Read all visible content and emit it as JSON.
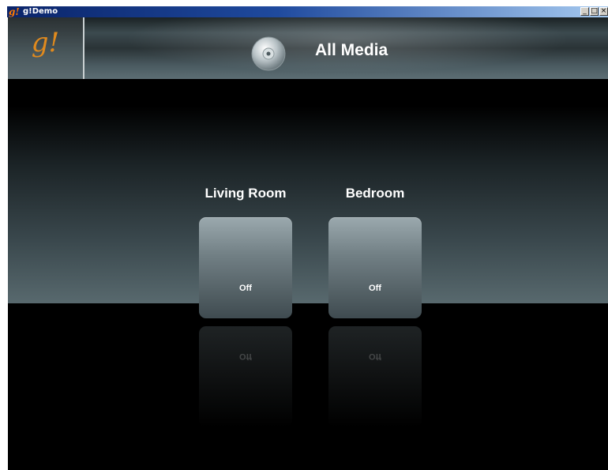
{
  "window": {
    "title": "g!Demo",
    "icon": "g-logo-icon",
    "controls": [
      "minimize-icon",
      "maximize-icon",
      "close-icon"
    ]
  },
  "header": {
    "logo": "g!",
    "icon": "disc-icon",
    "title": "All Media"
  },
  "rooms": [
    {
      "name": "Living Room",
      "status": "Off"
    },
    {
      "name": "Bedroom",
      "status": "Off"
    }
  ],
  "colors": {
    "logo": "#e08a1e",
    "titlebar": "#0a246a",
    "background": "#000000"
  }
}
